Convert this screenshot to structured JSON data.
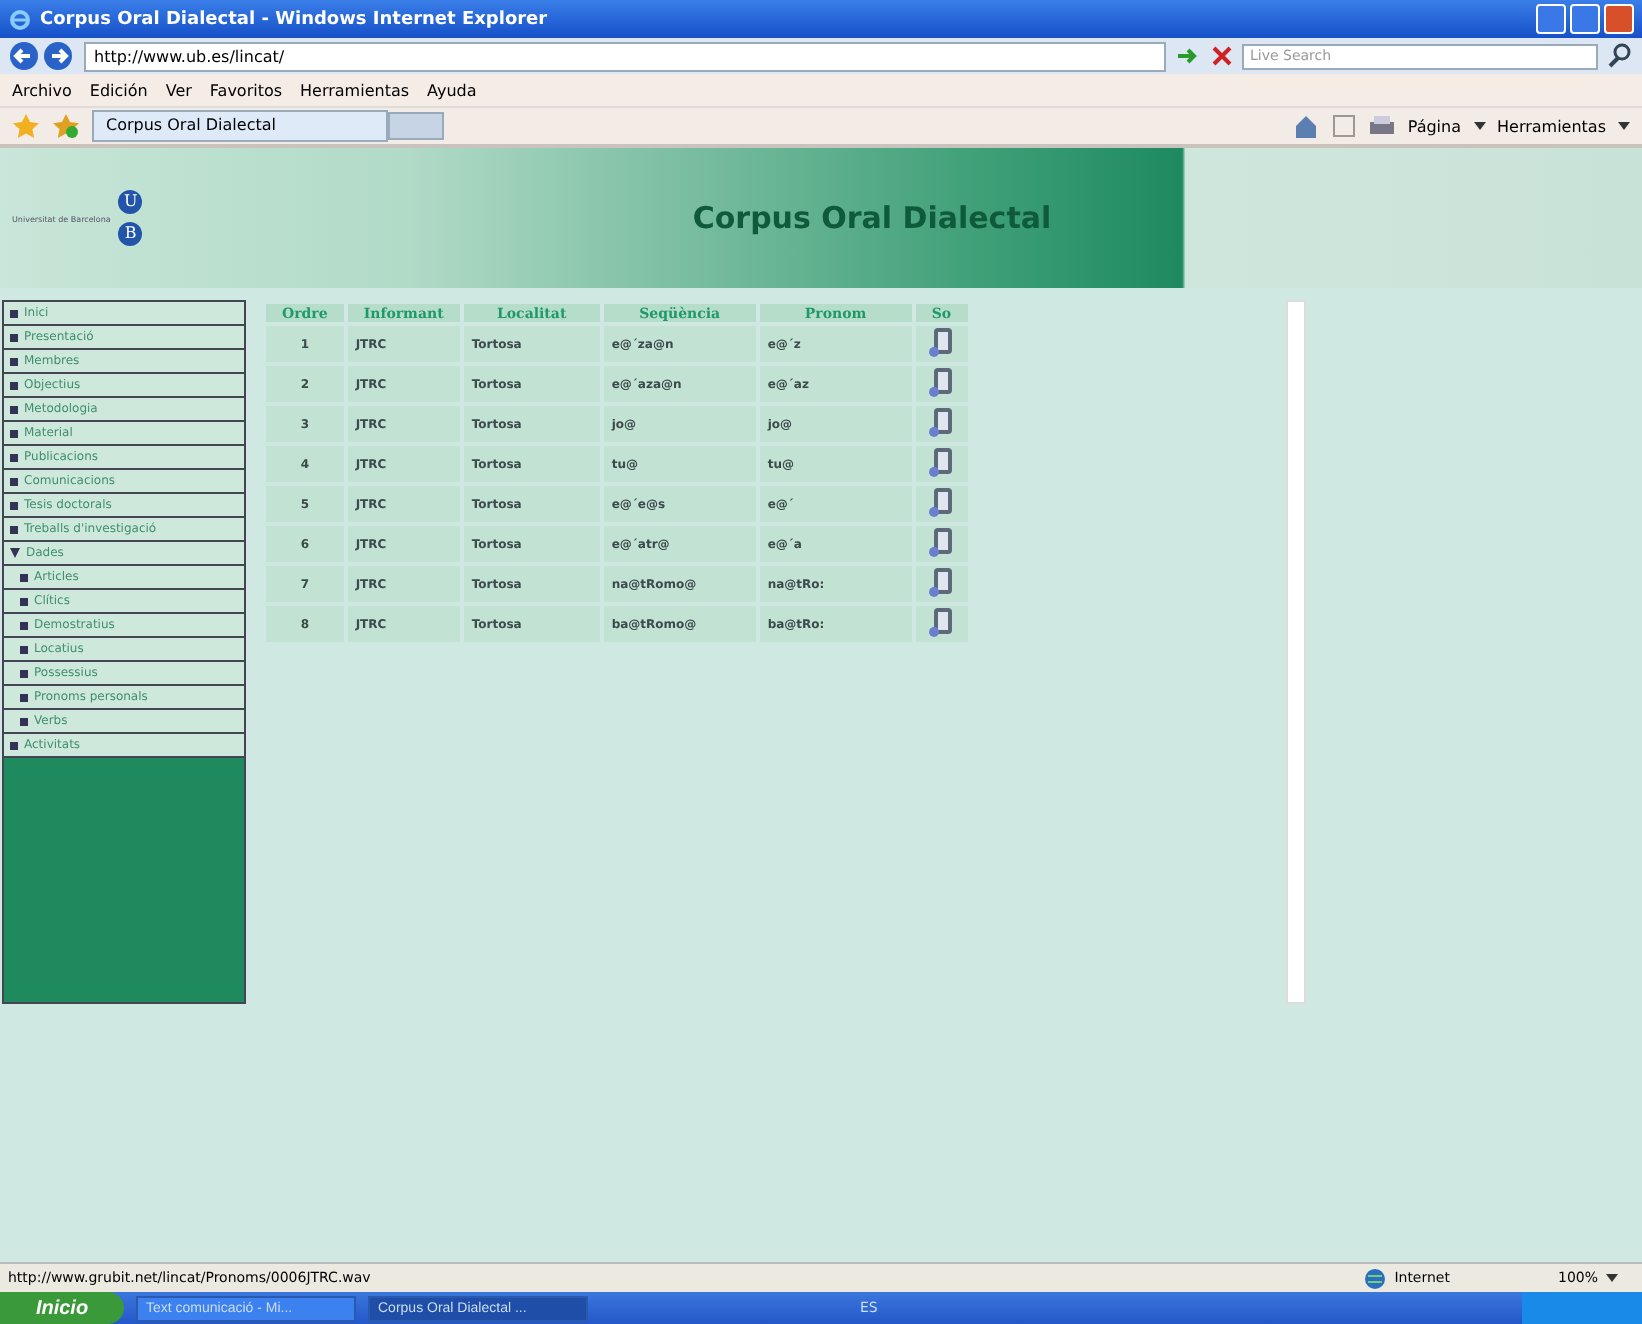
{
  "window": {
    "title": "Corpus Oral Dialectal - Windows Internet Explorer"
  },
  "address_bar": {
    "url": "http://www.ub.es/lincat/",
    "search_placeholder": "Live Search"
  },
  "menu": [
    "Archivo",
    "Edición",
    "Ver",
    "Favoritos",
    "Herramientas",
    "Ayuda"
  ],
  "tab": {
    "label": "Corpus Oral Dialectal"
  },
  "command_bar": [
    "Página",
    "Herramientas"
  ],
  "banner": {
    "logo_letters": [
      "U",
      "B"
    ],
    "logo_text": "Universitat de Barcelona",
    "title": "Corpus Oral Dialectal"
  },
  "sidebar": {
    "items": [
      {
        "label": "Inici",
        "expanded": false
      },
      {
        "label": "Presentació",
        "expanded": false
      },
      {
        "label": "Membres",
        "expanded": false
      },
      {
        "label": "Objectius",
        "expanded": false
      },
      {
        "label": "Metodologia",
        "expanded": false
      },
      {
        "label": "Material",
        "expanded": false
      },
      {
        "label": "Publicacions",
        "expanded": false
      },
      {
        "label": "Comunicacions",
        "expanded": false
      },
      {
        "label": "Tesis doctorals",
        "expanded": false
      },
      {
        "label": "Treballs d'investigació",
        "expanded": false
      },
      {
        "label": "Dades",
        "expanded": true,
        "children": [
          {
            "label": "Articles"
          },
          {
            "label": "Clítics"
          },
          {
            "label": "Demostratius"
          },
          {
            "label": "Locatius"
          },
          {
            "label": "Possessius"
          },
          {
            "label": "Pronoms personals"
          },
          {
            "label": "Verbs"
          }
        ]
      },
      {
        "label": "Activitats",
        "expanded": false
      }
    ]
  },
  "table": {
    "columns": [
      "Ordre",
      "Informant",
      "Localitat",
      "Seqüència",
      "Pronom",
      "So"
    ],
    "rows": [
      {
        "cells": [
          "1",
          "JTRC",
          "Tortosa",
          "e@´za@n",
          "e@´z"
        ]
      },
      {
        "cells": [
          "2",
          "JTRC",
          "Tortosa",
          "e@´aza@n",
          "e@´az"
        ]
      },
      {
        "cells": [
          "3",
          "JTRC",
          "Tortosa",
          "jo@",
          "jo@"
        ]
      },
      {
        "cells": [
          "4",
          "JTRC",
          "Tortosa",
          "tu@",
          "tu@"
        ]
      },
      {
        "cells": [
          "5",
          "JTRC",
          "Tortosa",
          "e@´e@s",
          "e@´"
        ]
      },
      {
        "cells": [
          "6",
          "JTRC",
          "Tortosa",
          "e@´atr@",
          "e@´a"
        ]
      },
      {
        "cells": [
          "7",
          "JTRC",
          "Tortosa",
          "na@tRomo@",
          "na@tRo:"
        ]
      },
      {
        "cells": [
          "8",
          "JTRC",
          "Tortosa",
          "ba@tRomo@",
          "ba@tRo:"
        ]
      }
    ]
  },
  "status_bar": {
    "url": "http://www.grubit.net/lincat/Pronoms/0006JTRC.wav",
    "zone": "Internet",
    "zoom": "100%"
  },
  "taskbar": {
    "start": "Inicio",
    "tasks": [
      {
        "label": "Text comunicació - Mi...",
        "selected": false
      },
      {
        "label": "Corpus Oral Dialectal ...",
        "selected": true
      }
    ],
    "language": "ES"
  }
}
